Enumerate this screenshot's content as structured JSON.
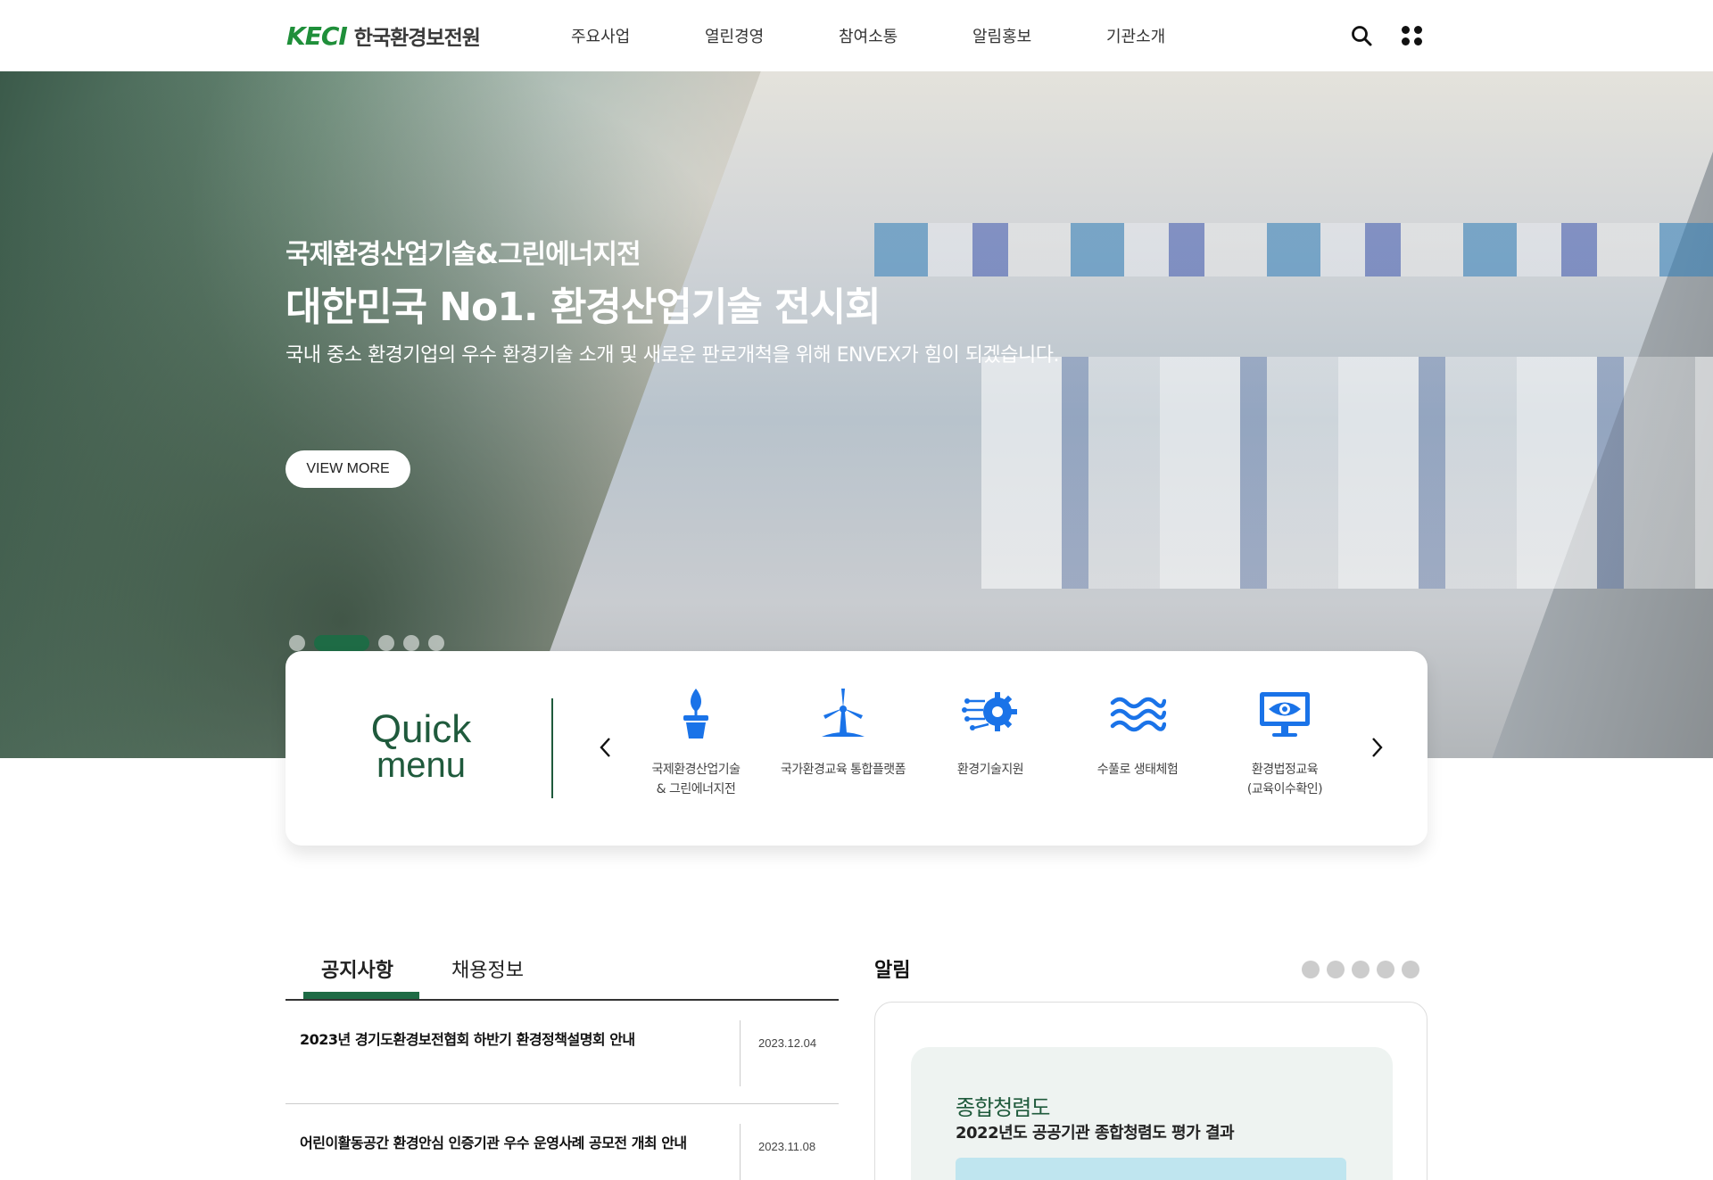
{
  "header": {
    "logo_mark": "KECI",
    "logo_text": "한국환경보전원",
    "nav": [
      "주요사업",
      "열린경영",
      "참여소통",
      "알림홍보",
      "기관소개"
    ]
  },
  "hero": {
    "subtitle": "국제환경산업기술&그린에너지전",
    "title": "대한민국 No1. 환경산업기술 전시회",
    "description": "국내 중소 환경기업의 우수 환경기술 소개 및 새로운 판로개척을 위해 ENVEX가 힘이 되겠습니다.",
    "button_label": "VIEW MORE",
    "slides_count": 5,
    "active_slide": 2
  },
  "quick_menu": {
    "title_line1": "Quick",
    "title_line2": "menu",
    "items": [
      {
        "label": "국제환경산업기술\n& 그린에너지전",
        "icon": "plant-pot-icon"
      },
      {
        "label": "국가환경교육 통합플랫폼",
        "icon": "wind-turbine-icon"
      },
      {
        "label": "환경기술지원",
        "icon": "gear-circuit-icon"
      },
      {
        "label": "수풀로 생태체험",
        "icon": "water-waves-icon"
      },
      {
        "label": "환경법정교육\n(교육이수확인)",
        "icon": "monitor-eye-icon"
      }
    ]
  },
  "notice": {
    "tabs": [
      "공지사항",
      "채용정보"
    ],
    "active_tab": 0,
    "items": [
      {
        "title": "2023년 경기도환경보전협회 하반기 환경정책설명회 안내",
        "date": "2023.12.04"
      },
      {
        "title": "어린이활동공간 환경안심 인증기관 우수 운영사례 공모전 개최 안내",
        "date": "2023.11.08"
      }
    ]
  },
  "alert": {
    "title": "알림",
    "pager_count": 5,
    "card_heading": "종합청렴도",
    "card_subtitle": "2022년도 공공기관 종합청렴도 평가 결과"
  },
  "colors": {
    "brand_green": "#1e6b45",
    "icon_blue": "#1a73e8",
    "card_bg": "#eef3f1"
  }
}
